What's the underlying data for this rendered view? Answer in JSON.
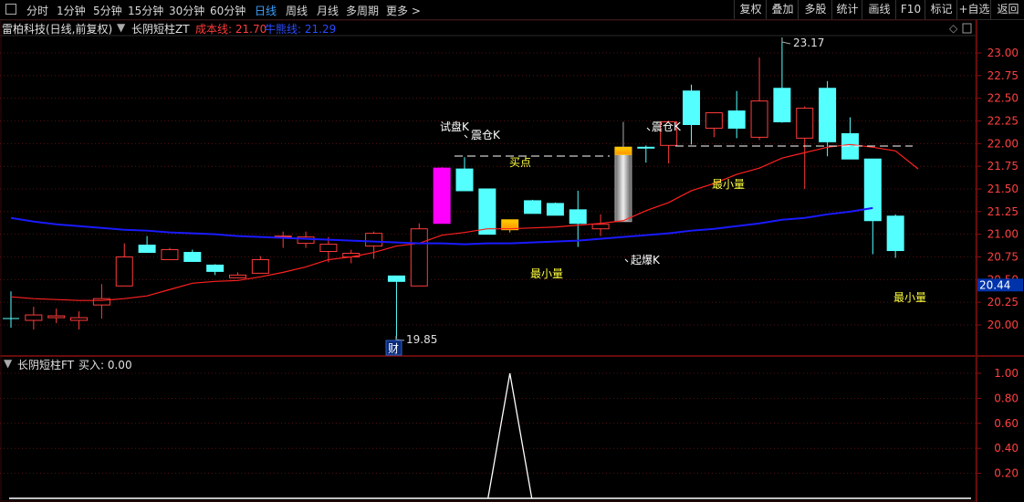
{
  "toolbar": {
    "tabs": [
      "分时",
      "1分钟",
      "5分钟",
      "15分钟",
      "30分钟",
      "60分钟",
      "日线",
      "周线",
      "月线",
      "多周期",
      "更多 >"
    ],
    "active_index": 6,
    "right_buttons": [
      "复权",
      "叠加",
      "多股",
      "统计",
      "画线",
      "F10",
      "标记",
      "+自选",
      "返回"
    ]
  },
  "legend": {
    "stock": "雷柏科技(日线,前复权)",
    "indicator": "长阴短柱ZT",
    "cost_label": "成本线: 21.70",
    "ma_label": "牛熊线: 21.29"
  },
  "sub_legend": {
    "indicator": "长阴短柱FT",
    "buy_label": "买入: 0.00"
  },
  "annotations": {
    "high": "23.17",
    "low": "19.85",
    "cai": "财",
    "trial": "试盘K",
    "shake1": "震仓K",
    "buy": "买点",
    "shake2": "震仓K",
    "burst": "起爆K",
    "min1": "最小量",
    "min2": "最小量",
    "min3": "最小量",
    "current_price": "20.44"
  },
  "colors": {
    "up": "#ff3b3b",
    "down": "#54ffff",
    "cost_line": "#ff2020",
    "bull_bear_line": "#1a1aff",
    "axis_text": "#ff4040",
    "magenta": "#ff00ff",
    "gold": "#ffc000",
    "price_box": "#0033aa"
  },
  "chart_data": {
    "type": "candlestick",
    "ylim": [
      19.8,
      23.3
    ],
    "price_ticks": [
      "23.00",
      "22.75",
      "22.50",
      "22.25",
      "22.00",
      "21.75",
      "21.50",
      "21.25",
      "21.00",
      "20.75",
      "20.50",
      "20.25",
      "20.00"
    ],
    "sub_ylim": [
      0,
      1.2
    ],
    "sub_ticks": [
      "1.00",
      "0.80",
      "0.60",
      "0.40",
      "0.20"
    ],
    "candles": [
      {
        "o": 20.07,
        "h": 20.37,
        "l": 19.97,
        "c": 20.07,
        "t": "doji"
      },
      {
        "o": 20.05,
        "h": 20.2,
        "l": 19.95,
        "c": 20.11,
        "t": "up"
      },
      {
        "o": 20.08,
        "h": 20.18,
        "l": 20.02,
        "c": 20.1,
        "t": "up"
      },
      {
        "o": 20.05,
        "h": 20.15,
        "l": 19.95,
        "c": 20.08,
        "t": "up"
      },
      {
        "o": 20.22,
        "h": 20.45,
        "l": 20.07,
        "c": 20.29,
        "t": "up"
      },
      {
        "o": 20.43,
        "h": 20.9,
        "l": 20.43,
        "c": 20.75,
        "t": "up"
      },
      {
        "o": 20.88,
        "h": 20.98,
        "l": 20.83,
        "c": 20.8,
        "t": "down"
      },
      {
        "o": 20.72,
        "h": 20.85,
        "l": 20.72,
        "c": 20.83,
        "t": "up"
      },
      {
        "o": 20.8,
        "h": 20.83,
        "l": 20.7,
        "c": 20.7,
        "t": "down"
      },
      {
        "o": 20.66,
        "h": 20.67,
        "l": 20.55,
        "c": 20.59,
        "t": "down"
      },
      {
        "o": 20.52,
        "h": 20.58,
        "l": 20.52,
        "c": 20.55,
        "t": "up"
      },
      {
        "o": 20.57,
        "h": 20.76,
        "l": 20.57,
        "c": 20.72,
        "t": "up"
      },
      {
        "o": 20.98,
        "h": 21.03,
        "l": 20.85,
        "c": 20.98,
        "t": "up"
      },
      {
        "o": 20.9,
        "h": 21.03,
        "l": 20.85,
        "c": 20.97,
        "t": "up"
      },
      {
        "o": 20.89,
        "h": 20.97,
        "l": 20.69,
        "c": 20.81,
        "t": "up"
      },
      {
        "o": 20.75,
        "h": 20.83,
        "l": 20.68,
        "c": 20.79,
        "t": "up"
      },
      {
        "o": 20.87,
        "h": 21.03,
        "l": 20.73,
        "c": 21.01,
        "t": "up"
      },
      {
        "o": 20.48,
        "h": 20.52,
        "l": 19.85,
        "c": 20.54,
        "t": "down"
      },
      {
        "o": 20.43,
        "h": 21.12,
        "l": 20.43,
        "c": 21.06,
        "t": "up"
      },
      {
        "o": 21.73,
        "h": 21.74,
        "l": 21.12,
        "c": 21.12,
        "t": "magenta"
      },
      {
        "o": 21.72,
        "h": 21.85,
        "l": 21.48,
        "c": 21.48,
        "t": "down"
      },
      {
        "o": 21.5,
        "h": 21.5,
        "l": 21.0,
        "c": 21.0,
        "t": "down"
      },
      {
        "o": 21.05,
        "h": 21.16,
        "l": 21.02,
        "c": 21.16,
        "t": "gold"
      },
      {
        "o": 21.37,
        "h": 21.38,
        "l": 21.23,
        "c": 21.23,
        "t": "down"
      },
      {
        "o": 21.34,
        "h": 21.35,
        "l": 21.23,
        "c": 21.21,
        "t": "down"
      },
      {
        "o": 21.27,
        "h": 21.48,
        "l": 20.86,
        "c": 21.12,
        "t": "down"
      },
      {
        "o": 21.06,
        "h": 21.22,
        "l": 20.98,
        "c": 21.11,
        "t": "up"
      },
      {
        "o": 21.14,
        "h": 22.24,
        "l": 21.14,
        "c": 21.96,
        "t": "bigsilver"
      },
      {
        "o": 21.96,
        "h": 21.98,
        "l": 21.79,
        "c": 21.96,
        "t": "down"
      },
      {
        "o": 21.98,
        "h": 22.25,
        "l": 21.78,
        "c": 22.24,
        "t": "up"
      },
      {
        "o": 22.58,
        "h": 22.65,
        "l": 21.99,
        "c": 22.21,
        "t": "down"
      },
      {
        "o": 22.17,
        "h": 22.27,
        "l": 22.07,
        "c": 22.34,
        "t": "up"
      },
      {
        "o": 22.36,
        "h": 22.58,
        "l": 22.06,
        "c": 22.17,
        "t": "down"
      },
      {
        "o": 22.07,
        "h": 22.95,
        "l": 22.04,
        "c": 22.47,
        "t": "up"
      },
      {
        "o": 22.61,
        "h": 23.17,
        "l": 22.23,
        "c": 22.24,
        "t": "down"
      },
      {
        "o": 22.06,
        "h": 22.41,
        "l": 21.5,
        "c": 22.39,
        "t": "up"
      },
      {
        "o": 22.61,
        "h": 22.69,
        "l": 21.86,
        "c": 22.02,
        "t": "down"
      },
      {
        "o": 22.11,
        "h": 22.29,
        "l": 21.9,
        "c": 21.83,
        "t": "down"
      },
      {
        "o": 21.83,
        "h": 21.82,
        "l": 20.78,
        "c": 21.15,
        "t": "down"
      },
      {
        "o": 21.2,
        "h": 21.22,
        "l": 20.74,
        "c": 20.82,
        "t": "down"
      }
    ],
    "cost_line": [
      20.31,
      20.29,
      20.28,
      20.27,
      20.27,
      20.29,
      20.32,
      20.39,
      20.46,
      20.48,
      20.49,
      20.53,
      20.58,
      20.64,
      20.72,
      20.75,
      20.8,
      20.87,
      20.9,
      20.99,
      21.02,
      21.06,
      21.06,
      21.07,
      21.08,
      21.1,
      21.12,
      21.15,
      21.26,
      21.35,
      21.48,
      21.56,
      21.66,
      21.73,
      21.84,
      21.9,
      21.96,
      21.99,
      21.96,
      21.92,
      21.72
    ],
    "bull_bear_line": [
      21.18,
      21.14,
      21.11,
      21.09,
      21.07,
      21.05,
      21.04,
      21.02,
      21.01,
      21.0,
      20.98,
      20.97,
      20.96,
      20.95,
      20.94,
      20.93,
      20.92,
      20.91,
      20.9,
      20.9,
      20.89,
      20.9,
      20.9,
      20.91,
      20.92,
      20.93,
      20.95,
      20.97,
      20.99,
      21.01,
      21.04,
      21.06,
      21.09,
      21.12,
      21.16,
      21.18,
      21.22,
      21.25,
      21.29
    ],
    "buy_signal": [
      0,
      0,
      0,
      0,
      0,
      0,
      0,
      0,
      0,
      0,
      0,
      0,
      0,
      0,
      0,
      0,
      0,
      0,
      0,
      0,
      0,
      0,
      1,
      0,
      0,
      0,
      0,
      0,
      0,
      0,
      0,
      0,
      0,
      0,
      0,
      0,
      0,
      0,
      0,
      0
    ]
  }
}
